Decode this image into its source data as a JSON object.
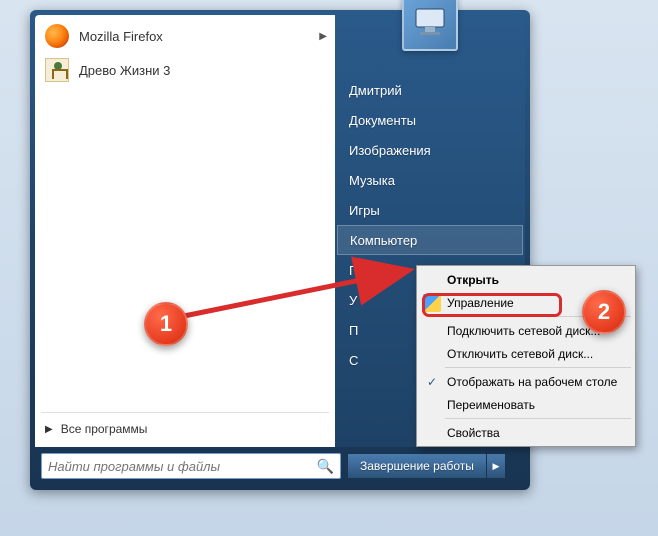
{
  "programs": [
    {
      "label": "Mozilla Firefox",
      "has_submenu": true
    },
    {
      "label": "Древо Жизни 3",
      "has_submenu": false
    }
  ],
  "all_programs_label": "Все программы",
  "right_items": [
    "Дмитрий",
    "Документы",
    "Изображения",
    "Музыка",
    "Игры",
    "Компьютер",
    "П",
    "У",
    "П",
    "С"
  ],
  "highlighted_right_index": 5,
  "search_placeholder": "Найти программы и файлы",
  "shutdown_label": "Завершение работы",
  "context_menu": {
    "items": [
      {
        "label": "Открыть",
        "bold": true
      },
      {
        "label": "Управление",
        "shield": true,
        "highlight": true
      },
      {
        "sep": true
      },
      {
        "label": "Подключить сетевой диск..."
      },
      {
        "label": "Отключить сетевой диск..."
      },
      {
        "sep": true
      },
      {
        "label": "Отображать на рабочем столе",
        "check": true
      },
      {
        "label": "Переименовать"
      },
      {
        "sep": true
      },
      {
        "label": "Свойства"
      }
    ]
  },
  "callouts": {
    "one": "1",
    "two": "2"
  }
}
